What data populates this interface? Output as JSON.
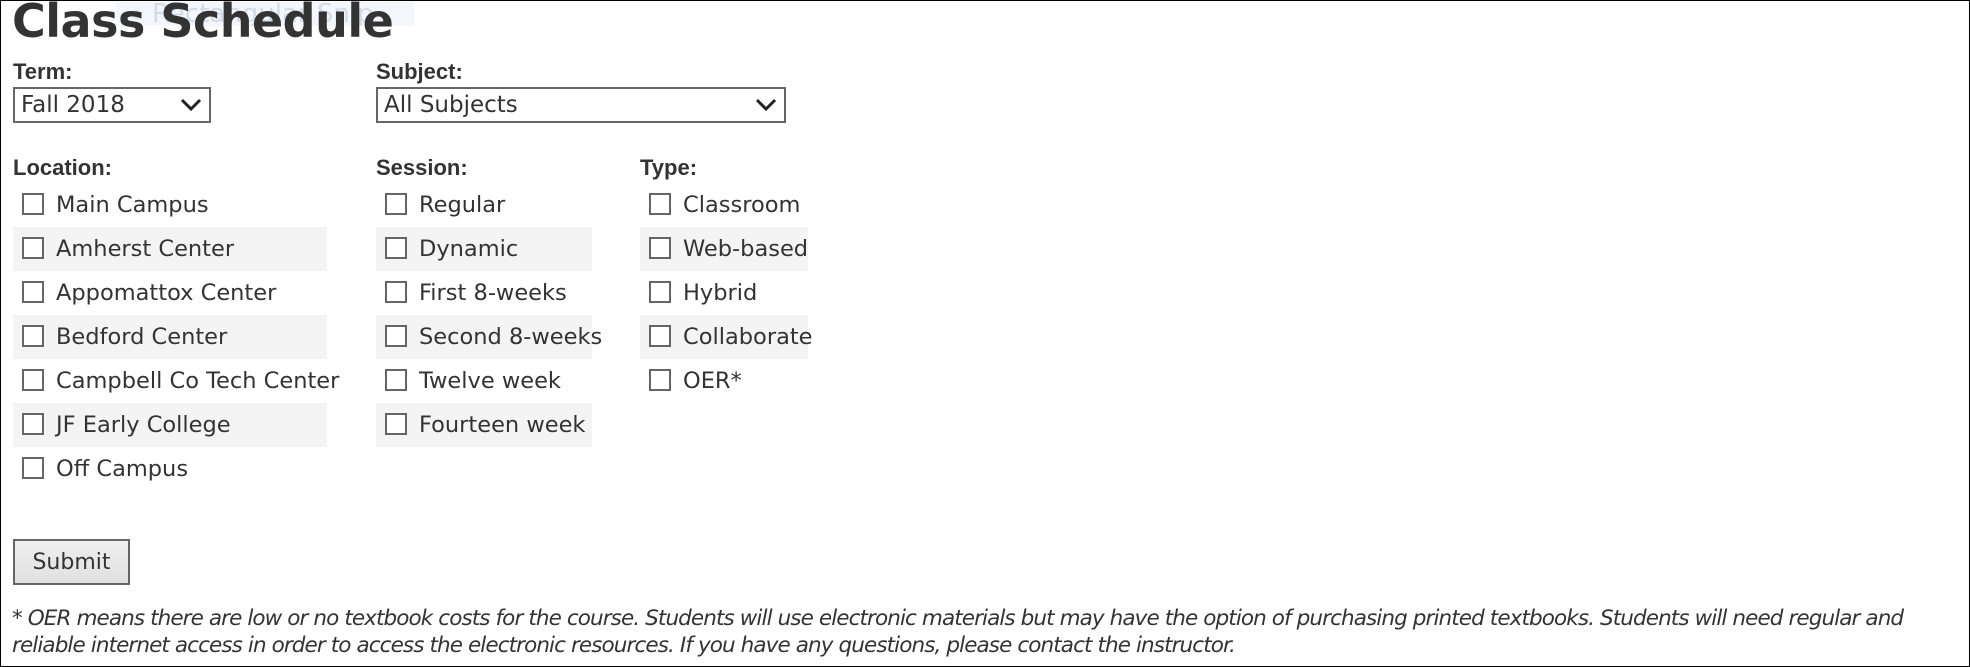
{
  "overlay": {
    "ghost_text": "Rectangular Snip"
  },
  "page": {
    "title": "Class Schedule"
  },
  "term": {
    "label": "Term:",
    "selected": "Fall 2018"
  },
  "subject": {
    "label": "Subject:",
    "selected": "All Subjects"
  },
  "location": {
    "label": "Location:",
    "options": [
      {
        "label": "Main Campus",
        "checked": false
      },
      {
        "label": "Amherst Center",
        "checked": false
      },
      {
        "label": "Appomattox Center",
        "checked": false
      },
      {
        "label": "Bedford Center",
        "checked": false
      },
      {
        "label": "Campbell Co Tech Center",
        "checked": false
      },
      {
        "label": "JF Early College",
        "checked": false
      },
      {
        "label": "Off Campus",
        "checked": false
      }
    ]
  },
  "session": {
    "label": "Session:",
    "options": [
      {
        "label": "Regular",
        "checked": false
      },
      {
        "label": "Dynamic",
        "checked": false
      },
      {
        "label": "First 8-weeks",
        "checked": false
      },
      {
        "label": "Second 8-weeks",
        "checked": false
      },
      {
        "label": "Twelve week",
        "checked": false
      },
      {
        "label": "Fourteen week",
        "checked": false
      }
    ]
  },
  "type": {
    "label": "Type:",
    "options": [
      {
        "label": "Classroom",
        "checked": false
      },
      {
        "label": "Web-based",
        "checked": false
      },
      {
        "label": "Hybrid",
        "checked": false
      },
      {
        "label": "Collaborate",
        "checked": false
      },
      {
        "label": "OER*",
        "checked": false
      }
    ]
  },
  "form": {
    "submit_label": "Submit"
  },
  "footnote": "* OER means there are low or no textbook costs for the course. Students will use electronic materials but may have the option of purchasing printed textbooks. Students will need regular and reliable internet access in order to access the electronic resources. If you have any questions, please contact the instructor."
}
